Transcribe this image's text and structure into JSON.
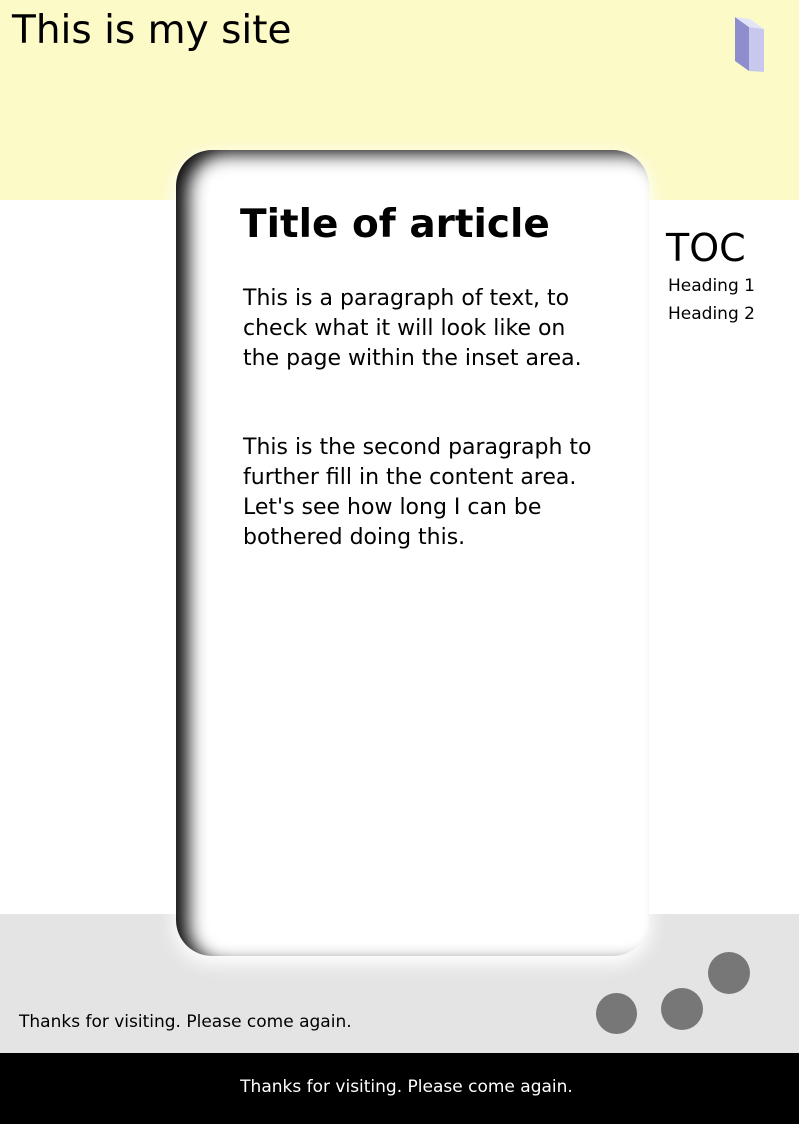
{
  "header": {
    "site_title": "This is my site",
    "icon": "book-icon",
    "background_color": "#fcfac6"
  },
  "article": {
    "title": "Title of article",
    "paragraphs": [
      "This is a paragraph of text, to check what it will look like on the page within the inset area.",
      "This is the second paragraph to further fill in the content area. Let's see how long I can be bothered doing this."
    ]
  },
  "toc": {
    "title": "TOC",
    "items": [
      "Heading 1",
      "Heading 2"
    ]
  },
  "footer": {
    "text": "Thanks for visiting. Please come again.",
    "bar_text": "Thanks for visiting. Please come again.",
    "band_color": "#e4e4e4",
    "dot_color": "#777777",
    "bar_color": "#000000"
  }
}
